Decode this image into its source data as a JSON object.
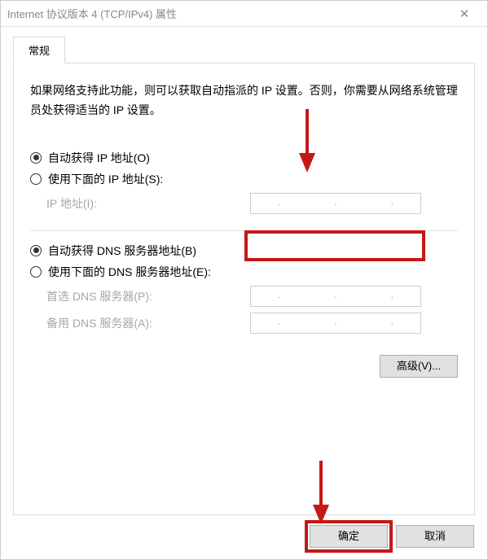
{
  "window": {
    "title": "Internet 协议版本 4 (TCP/IPv4) 属性"
  },
  "tab": {
    "general": "常规"
  },
  "desc": "如果网络支持此功能，则可以获取自动指派的 IP 设置。否则，你需要从网络系统管理员处获得适当的 IP 设置。",
  "ip": {
    "auto": "自动获得 IP 地址(O)",
    "manual": "使用下面的 IP 地址(S):",
    "addr_label": "IP 地址(I):"
  },
  "dns": {
    "auto": "自动获得 DNS 服务器地址(B)",
    "manual": "使用下面的 DNS 服务器地址(E):",
    "pref_label": "首选 DNS 服务器(P):",
    "alt_label": "备用 DNS 服务器(A):"
  },
  "advanced": "高级(V)...",
  "buttons": {
    "ok": "确定",
    "cancel": "取消"
  }
}
